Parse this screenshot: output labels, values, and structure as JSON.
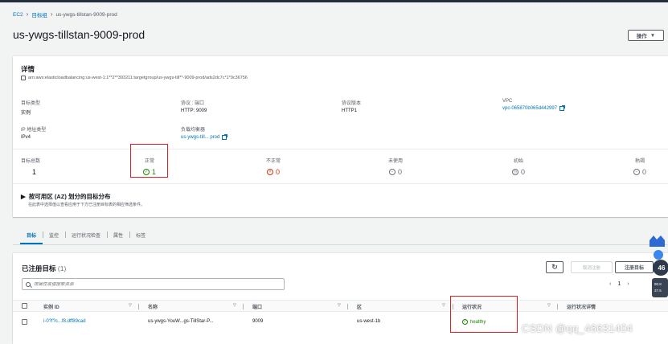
{
  "breadcrumb": {
    "ec2": "EC2",
    "target_groups": "目标组",
    "current": "us-ywgs-tillstan-9009-prod"
  },
  "page_title": "us-ywgs-tillstan-9009-prod",
  "actions_label": "操作",
  "details": {
    "heading": "详情",
    "arn": "arn:aws:elasticloadbalancing:us-west-1:1**2**393211:targetgroup/us-ywgs-till**-9009-prod/ads2dc7c*1*9c36756",
    "target_type": {
      "label": "目标类型",
      "value": "实例"
    },
    "protocol_port": {
      "label": "协议 : 端口",
      "value": "HTTP: 9009"
    },
    "protocol_version": {
      "label": "协议版本",
      "value": "HTTP1"
    },
    "vpc": {
      "label": "VPC",
      "value": "vpc-065870b065d442997"
    },
    "ip_type": {
      "label": "IP 地址类型",
      "value": "IPv4"
    },
    "load_balancer": {
      "label": "负载均衡器",
      "value": "us-ywgs-till... prod"
    }
  },
  "stats": {
    "total": {
      "label": "目标总数",
      "value": "1"
    },
    "healthy": {
      "label": "正常",
      "value": "1"
    },
    "unhealthy": {
      "label": "不正常",
      "value": "0"
    },
    "unused": {
      "label": "未使用",
      "value": "0"
    },
    "initial": {
      "label": "初始",
      "value": "0"
    },
    "draining": {
      "label": "枯竭",
      "value": "0"
    }
  },
  "az": {
    "title": "按可用区 (AZ) 划分的目标分布",
    "desc": "在此表中选择值以查看应用于下方已注册目标表的相应筛选条件。"
  },
  "tabs": [
    "目标",
    "监控",
    "运行状况检查",
    "属性",
    "标签"
  ],
  "targets": {
    "heading": "已注册目标",
    "count": "(1)",
    "deregister_label": "取消注册",
    "register_label": "注册目标",
    "search_placeholder": "按属性或值搜索资源",
    "page": "1",
    "columns": [
      "实例 ID",
      "名称",
      "端口",
      "区",
      "运行状况",
      "运行状况详情"
    ],
    "rows": [
      {
        "instance_id": "i-0?f?c...f8.dff89cad",
        "name": "us-ywgs-YouW...gs-TillStar-P...",
        "port": "9009",
        "zone": "us-west-1b",
        "health": "healthy",
        "details": ""
      }
    ]
  },
  "watermark": "CSDN @qq_46631404",
  "side_widget": {
    "percent": "46",
    "up": "90.8",
    "down": "37.5"
  }
}
